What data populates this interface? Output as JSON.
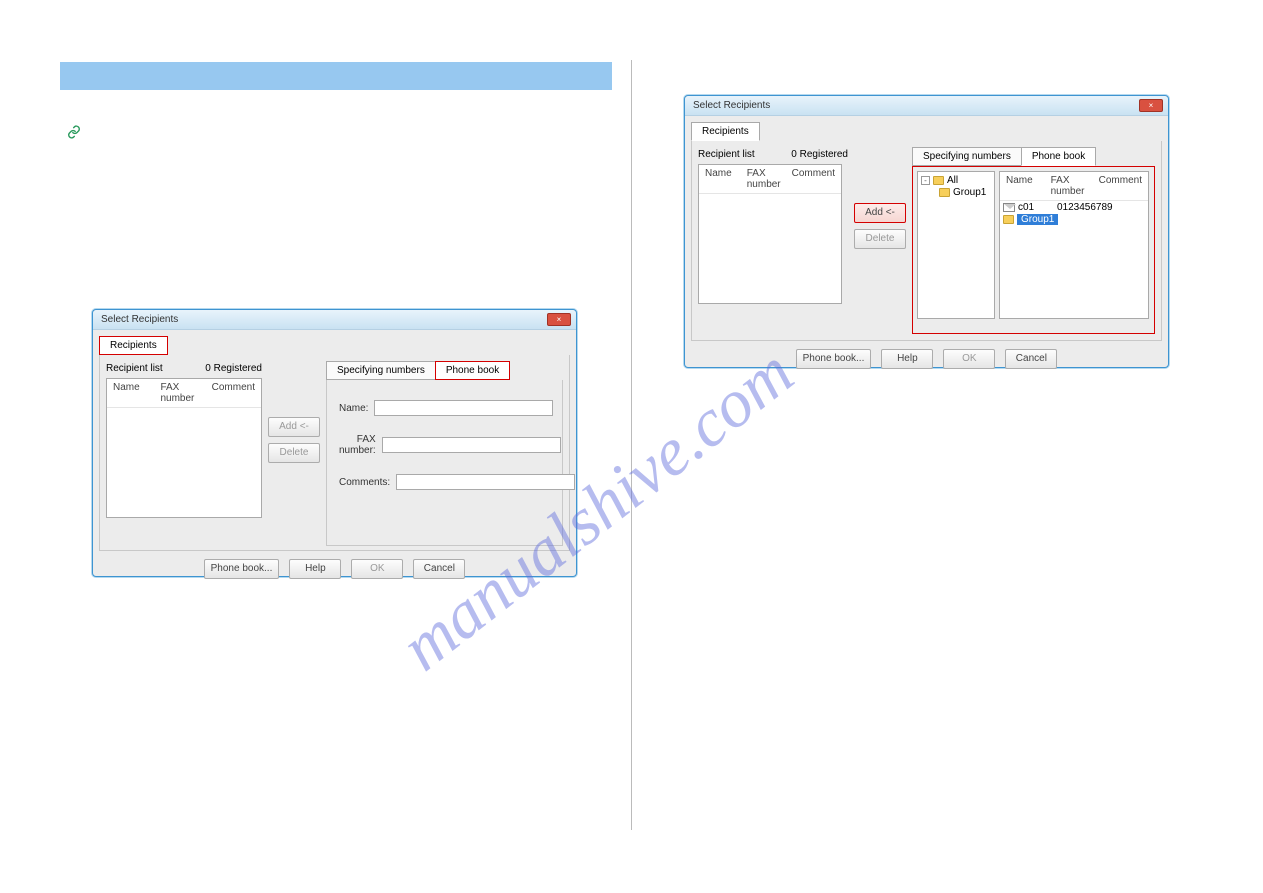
{
  "dialog": {
    "title": "Select Recipients",
    "close_glyph": "×",
    "tabs": {
      "recipients": "Recipients",
      "specifying_numbers": "Specifying numbers",
      "phone_book": "Phone book"
    },
    "recipient_list_label": "Recipient list",
    "registered_label": "0 Registered",
    "columns": {
      "name": "Name",
      "fax": "FAX number",
      "comment": "Comment"
    },
    "form": {
      "name_label": "Name:",
      "fax_label": "FAX number:",
      "comments_label": "Comments:"
    },
    "buttons": {
      "add": "Add <-",
      "delete": "Delete",
      "phone_book": "Phone book...",
      "help": "Help",
      "ok": "OK",
      "cancel": "Cancel"
    }
  },
  "tree": {
    "all": "All",
    "group1": "Group1"
  },
  "contacts": {
    "c01_name": "c01",
    "c01_fax": "0123456789",
    "group1": "Group1"
  }
}
